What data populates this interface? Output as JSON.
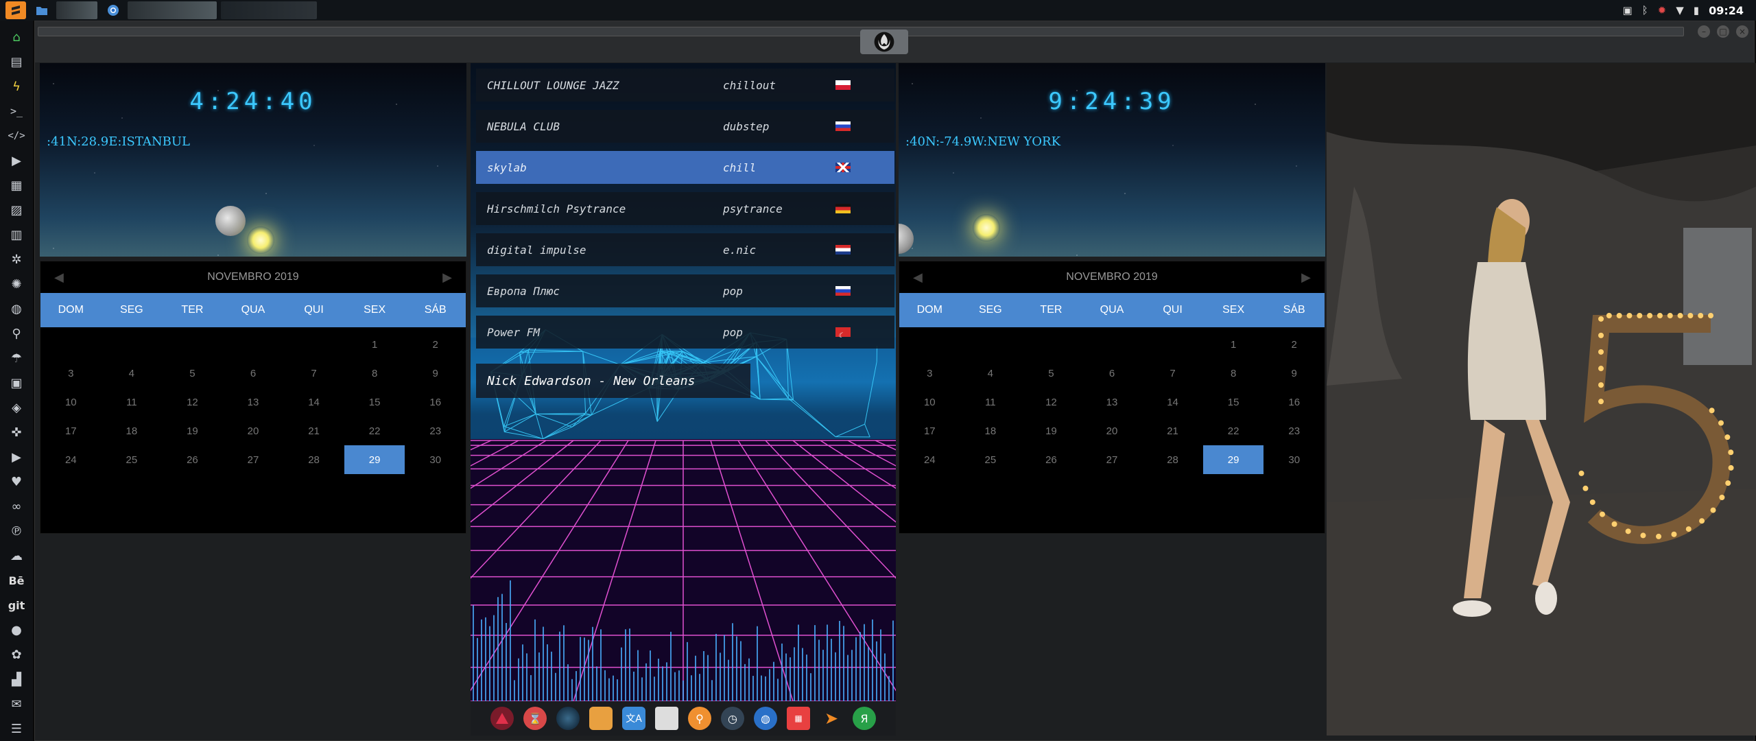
{
  "topbar": {
    "clock": "09:24",
    "tray_icons": [
      "image-icon",
      "bluetooth-icon",
      "bug-icon",
      "wifi-icon",
      "battery-icon"
    ]
  },
  "left_dock": {
    "text_items": [
      "Bē",
      "git"
    ]
  },
  "world_clocks": [
    {
      "time": "4:24:40",
      "location": ":41N:28.9E:ISTANBUL"
    },
    {
      "time": "9:24:39",
      "location": ":40N:-74.9W:NEW YORK"
    }
  ],
  "calendar": {
    "title": "NOVEMBRO 2019",
    "weekdays": [
      "DOM",
      "SEG",
      "TER",
      "QUA",
      "QUI",
      "SEX",
      "SÁB"
    ],
    "selected_day": "29"
  },
  "radio": {
    "stations": [
      {
        "name": "CHILLOUT LOUNGE JAZZ",
        "genre": "chillout",
        "flag": "poland-flag"
      },
      {
        "name": "NEBULA CLUB",
        "genre": "dubstep",
        "flag": "russia-flag"
      },
      {
        "name": "skylab",
        "genre": "chill",
        "flag": "uk-flag",
        "active": true
      },
      {
        "name": "Hirschmilch Psytrance",
        "genre": "psytrance",
        "flag": "germany-flag"
      },
      {
        "name": "digital impulse",
        "genre": "e.nic",
        "flag": "croatia-flag"
      },
      {
        "name": "Европа Плюс",
        "genre": "pop",
        "flag": "russia-flag"
      },
      {
        "name": "Power FM",
        "genre": "pop",
        "flag": "turkey-flag"
      }
    ],
    "now_playing": "Nick Edwardson - New Orleans"
  },
  "colors": {
    "accent": "#4a88d0",
    "clock_cyan": "#3cc8ff",
    "active_station": "#3d6bb8"
  }
}
